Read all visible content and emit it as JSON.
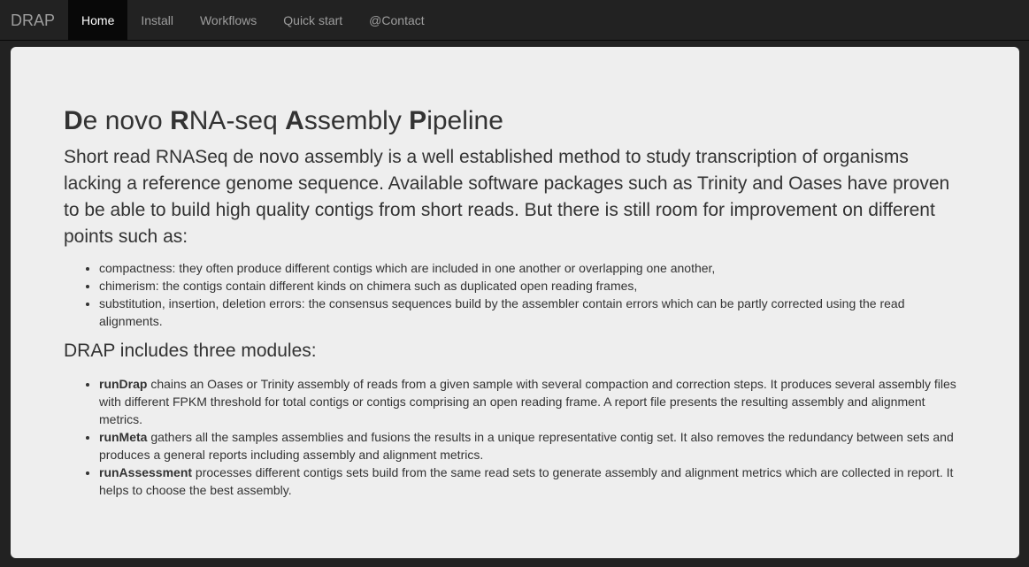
{
  "navbar": {
    "brand": "DRAP",
    "items": [
      {
        "label": "Home",
        "active": true
      },
      {
        "label": "Install"
      },
      {
        "label": "Workflows"
      },
      {
        "label": "Quick start"
      },
      {
        "label": "@Contact"
      }
    ]
  },
  "main": {
    "title": {
      "parts": [
        {
          "bold": "D",
          "rest": "e novo "
        },
        {
          "bold": "R",
          "rest": "NA-seq "
        },
        {
          "bold": "A",
          "rest": "ssembly "
        },
        {
          "bold": "P",
          "rest": "ipeline"
        }
      ]
    },
    "lead": "Short read RNASeq de novo assembly is a well established method to study transcription of organisms lacking a reference genome sequence. Available software packages such as Trinity and Oases have proven to be able to build high quality contigs from short reads. But there is still room for improvement on different points such as:",
    "points": [
      "compactness: they often produce different contigs which are included in one another or overlapping one another,",
      "chimerism: the contigs contain different kinds on chimera such as duplicated open reading frames,",
      "substitution, insertion, deletion errors: the consensus sequences build by the assembler contain errors which can be partly corrected using the read alignments."
    ],
    "modules_heading": "DRAP includes three modules:",
    "modules": [
      {
        "name": "runDrap",
        "text": " chains an Oases or Trinity assembly of reads from a given sample with several compaction and correction steps. It produces several assembly files with different FPKM threshold for total contigs or contigs comprising an open reading frame. A report file presents the resulting assembly and alignment metrics."
      },
      {
        "name": "runMeta",
        "text": " gathers all the samples assemblies and fusions the results in a unique representative contig set. It also removes the redundancy between sets and produces a general reports including assembly and alignment metrics."
      },
      {
        "name": "runAssessment",
        "text": " processes different contigs sets build from the same read sets to generate assembly and alignment metrics which are collected in report. It helps to choose the best assembly."
      }
    ]
  }
}
